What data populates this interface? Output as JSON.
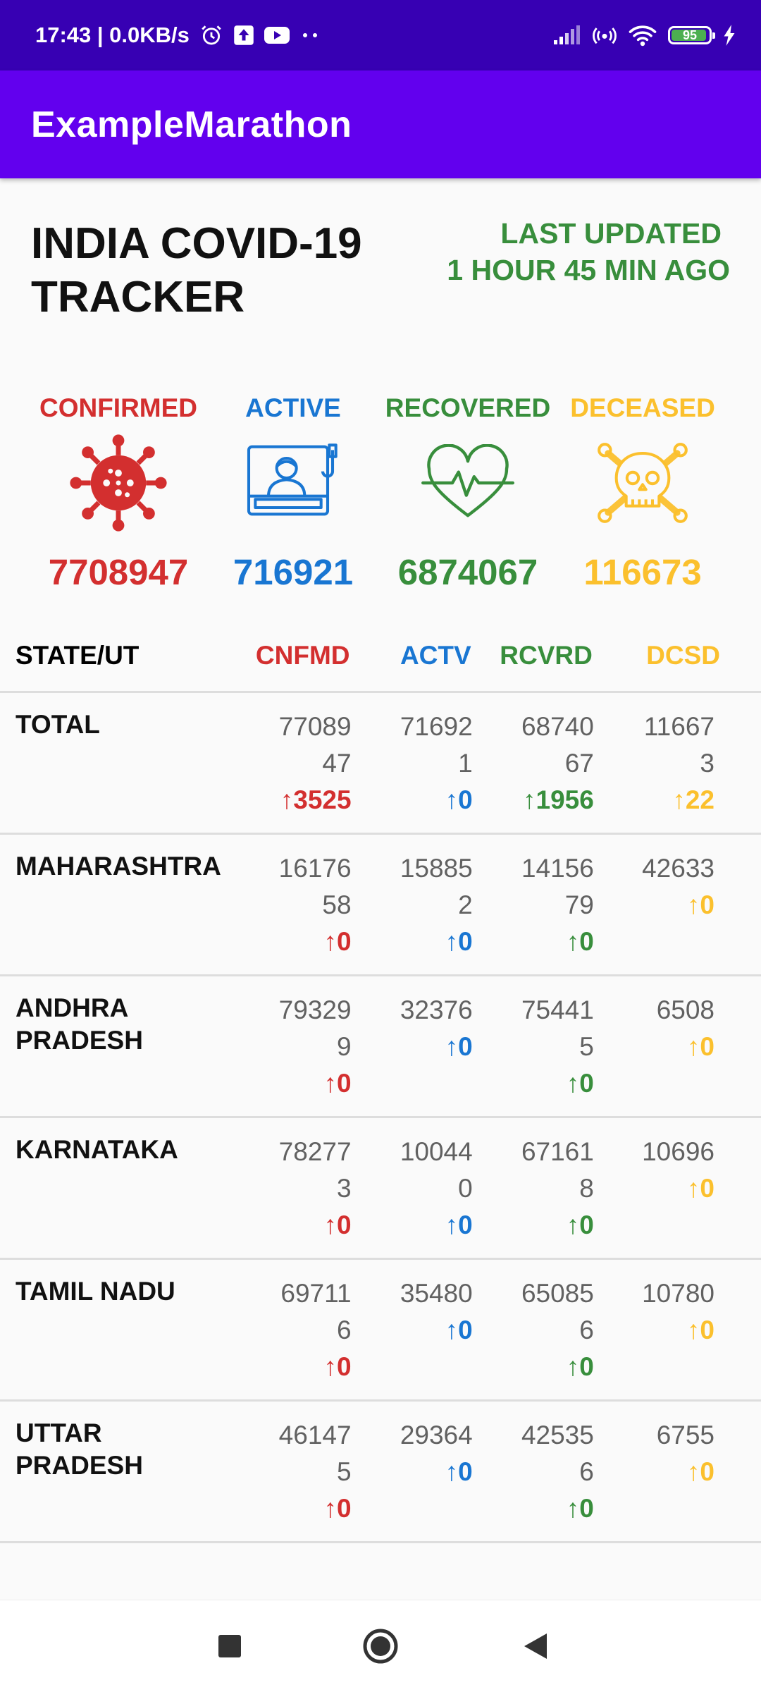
{
  "status_bar": {
    "time_speed": "17:43 | 0.0KB/s",
    "battery_level": "95",
    "icons": [
      "alarm-icon",
      "upload-icon",
      "youtube-icon",
      "more-dots-icon",
      "signal-icon",
      "hotspot-icon",
      "wifi-icon",
      "battery-icon",
      "charging-icon"
    ]
  },
  "app_bar": {
    "title": "ExampleMarathon"
  },
  "header": {
    "title_line1": "INDIA COVID-19",
    "title_line2": "TRACKER",
    "last_updated_line1": "LAST UPDATED",
    "last_updated_line2": "1 HOUR 45 MIN AGO"
  },
  "summary": [
    {
      "label": "CONFIRMED",
      "value": "7708947",
      "icon": "virus-icon",
      "color": "#d32f2f"
    },
    {
      "label": "ACTIVE",
      "value": "716921",
      "icon": "patient-bed-icon",
      "color": "#1976d2"
    },
    {
      "label": "RECOVERED",
      "value": "6874067",
      "icon": "heartbeat-icon",
      "color": "#388e3c"
    },
    {
      "label": "DECEASED",
      "value": "116673",
      "icon": "skull-crossbones-icon",
      "color": "#fbc02d"
    }
  ],
  "table": {
    "headers": [
      "STATE/UT",
      "CNFMD",
      "ACTV",
      "RCVRD",
      "DCSD"
    ],
    "rows": [
      {
        "state": "TOTAL",
        "confirmed": "7708947",
        "confirmed_delta": "↑3525",
        "active": "716921",
        "active_delta": "↑0",
        "recovered": "6874067",
        "recovered_delta": "↑1956",
        "deceased": "116673",
        "deceased_delta": "↑22"
      },
      {
        "state": "MAHARASHTRA",
        "confirmed": "1617658",
        "confirmed_delta": "↑0",
        "active": "158852",
        "active_delta": "↑0",
        "recovered": "1415679",
        "recovered_delta": "↑0",
        "deceased": "42633",
        "deceased_delta": "↑0"
      },
      {
        "state": "ANDHRA PRADESH",
        "confirmed": "793299",
        "confirmed_delta": "↑0",
        "active": "32376",
        "active_delta": "↑0",
        "recovered": "754415",
        "recovered_delta": "↑0",
        "deceased": "6508",
        "deceased_delta": "↑0"
      },
      {
        "state": "KARNATAKA",
        "confirmed": "782773",
        "confirmed_delta": "↑0",
        "active": "100440",
        "active_delta": "↑0",
        "recovered": "671618",
        "recovered_delta": "↑0",
        "deceased": "10696",
        "deceased_delta": "↑0"
      },
      {
        "state": "TAMIL NADU",
        "confirmed": "697116",
        "confirmed_delta": "↑0",
        "active": "35480",
        "active_delta": "↑0",
        "recovered": "650856",
        "recovered_delta": "↑0",
        "deceased": "10780",
        "deceased_delta": "↑0"
      },
      {
        "state": "UTTAR PRADESH",
        "confirmed": "461475",
        "confirmed_delta": "↑0",
        "active": "29364",
        "active_delta": "↑0",
        "recovered": "425356",
        "recovered_delta": "↑0",
        "deceased": "6755",
        "deceased_delta": "↑0"
      }
    ]
  },
  "nav_bar": {
    "buttons": [
      "recents-button",
      "home-button",
      "back-button"
    ]
  }
}
